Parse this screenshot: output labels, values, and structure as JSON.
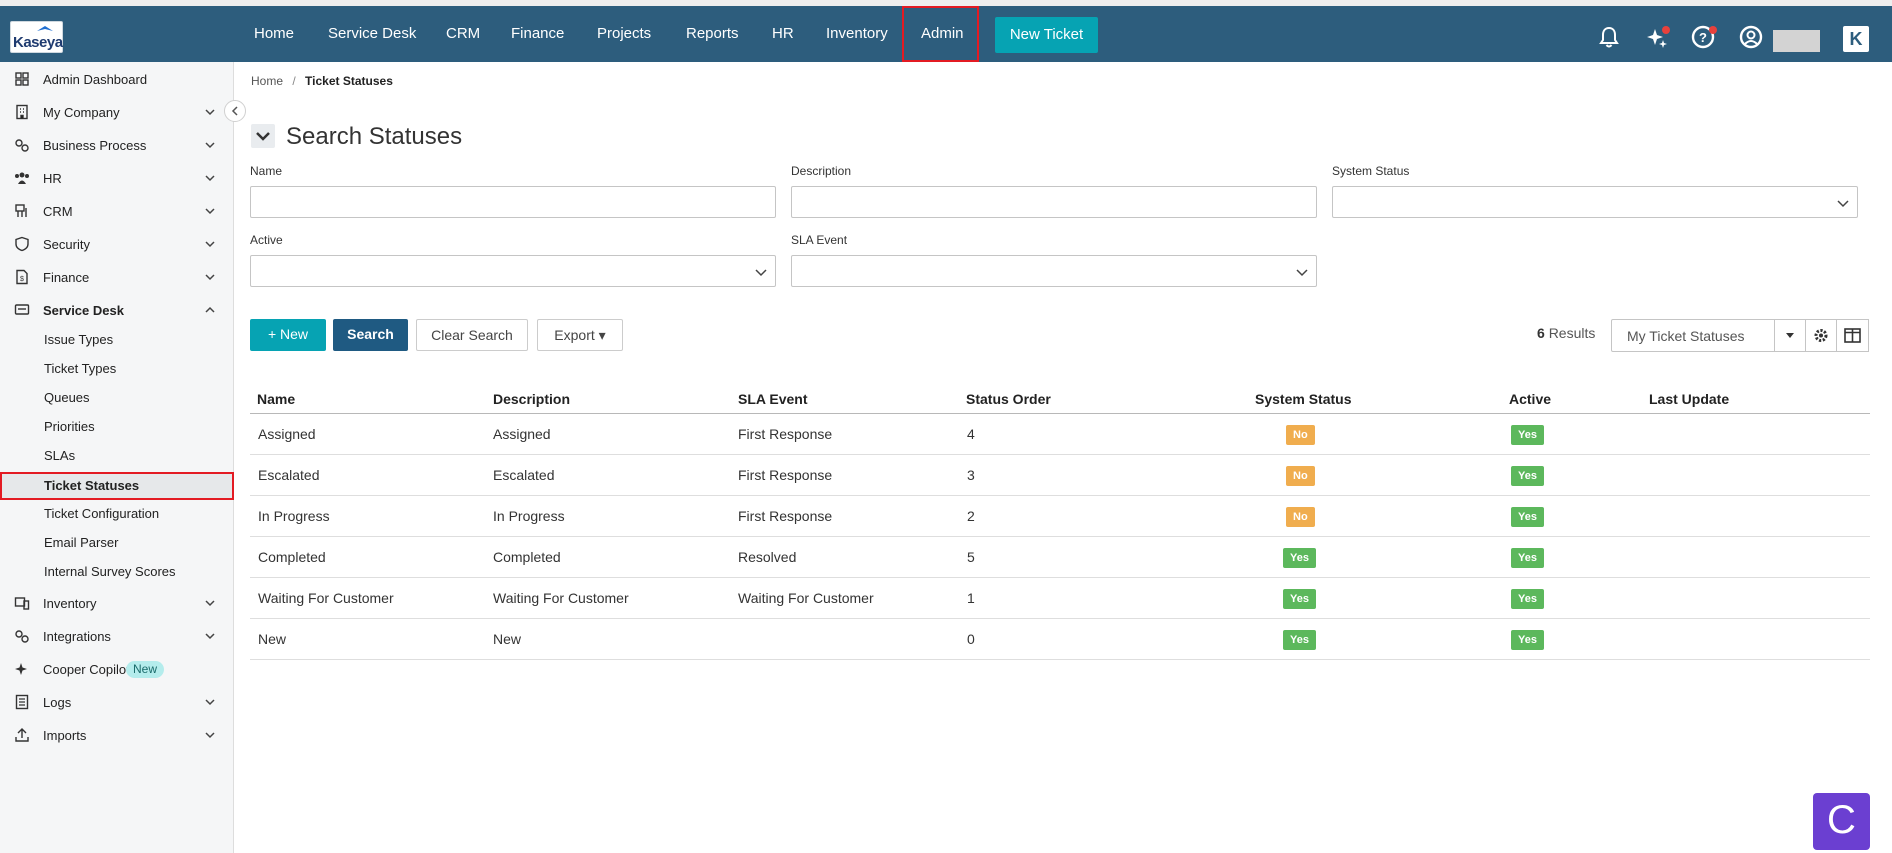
{
  "app": {
    "logo_text": "Kaseya"
  },
  "topnav": {
    "items": [
      "Home",
      "Service Desk",
      "CRM",
      "Finance",
      "Projects",
      "Reports",
      "HR",
      "Inventory",
      "Admin"
    ],
    "new_ticket_label": "New Ticket",
    "kaseya_mark": "K"
  },
  "sidebar": {
    "items": [
      {
        "label": "Admin Dashboard",
        "icon": "grid-icon"
      },
      {
        "label": "My Company",
        "icon": "building-icon"
      },
      {
        "label": "Business Process",
        "icon": "gears-icon"
      },
      {
        "label": "HR",
        "icon": "people-icon"
      },
      {
        "label": "CRM",
        "icon": "crm-icon"
      },
      {
        "label": "Security",
        "icon": "shield-icon"
      },
      {
        "label": "Finance",
        "icon": "invoice-icon"
      },
      {
        "label": "Service Desk",
        "icon": "desk-icon"
      }
    ],
    "service_desk_sub": [
      "Issue Types",
      "Ticket Types",
      "Queues",
      "Priorities",
      "SLAs",
      "Ticket Statuses",
      "Ticket Configuration",
      "Email Parser",
      "Internal Survey Scores"
    ],
    "items_after": [
      {
        "label": "Inventory",
        "icon": "devices-icon"
      },
      {
        "label": "Integrations",
        "icon": "integration-icon"
      },
      {
        "label": "Cooper Copilot",
        "icon": "sparkle-icon",
        "badge": "New"
      },
      {
        "label": "Logs",
        "icon": "log-icon"
      },
      {
        "label": "Imports",
        "icon": "upload-icon"
      }
    ]
  },
  "breadcrumb": {
    "home": "Home",
    "sep": "/",
    "current": "Ticket Statuses"
  },
  "search": {
    "title": "Search Statuses",
    "fields": {
      "name_label": "Name",
      "description_label": "Description",
      "system_status_label": "System Status",
      "active_label": "Active",
      "sla_event_label": "SLA Event"
    },
    "buttons": {
      "new": "+ New",
      "search": "Search",
      "clear": "Clear Search",
      "export": "Export ▾"
    }
  },
  "results": {
    "count": "6",
    "label": "Results",
    "view": "My Ticket Statuses"
  },
  "table": {
    "headers": [
      "Name",
      "Description",
      "SLA Event",
      "Status Order",
      "System Status",
      "Active",
      "Last Update"
    ],
    "rows": [
      {
        "name": "Assigned",
        "description": "Assigned",
        "sla_event": "First Response",
        "order": "4",
        "system": "No",
        "active": "Yes"
      },
      {
        "name": "Escalated",
        "description": "Escalated",
        "sla_event": "First Response",
        "order": "3",
        "system": "No",
        "active": "Yes"
      },
      {
        "name": "In Progress",
        "description": "In Progress",
        "sla_event": "First Response",
        "order": "2",
        "system": "No",
        "active": "Yes"
      },
      {
        "name": "Completed",
        "description": "Completed",
        "sla_event": "Resolved",
        "order": "5",
        "system": "Yes",
        "active": "Yes"
      },
      {
        "name": "Waiting For Customer",
        "description": "Waiting For Customer",
        "sla_event": "Waiting For Customer",
        "order": "1",
        "system": "Yes",
        "active": "Yes"
      },
      {
        "name": "New",
        "description": "New",
        "sla_event": "",
        "order": "0",
        "system": "Yes",
        "active": "Yes"
      }
    ]
  },
  "colors": {
    "nav": "#2d5d7d",
    "teal": "#06a3b3",
    "navy": "#1f5a82",
    "highlight": "#e31b23",
    "no": "#f0ad4e",
    "yes": "#5cb85c"
  },
  "floating": {
    "cooper_label": "C"
  }
}
